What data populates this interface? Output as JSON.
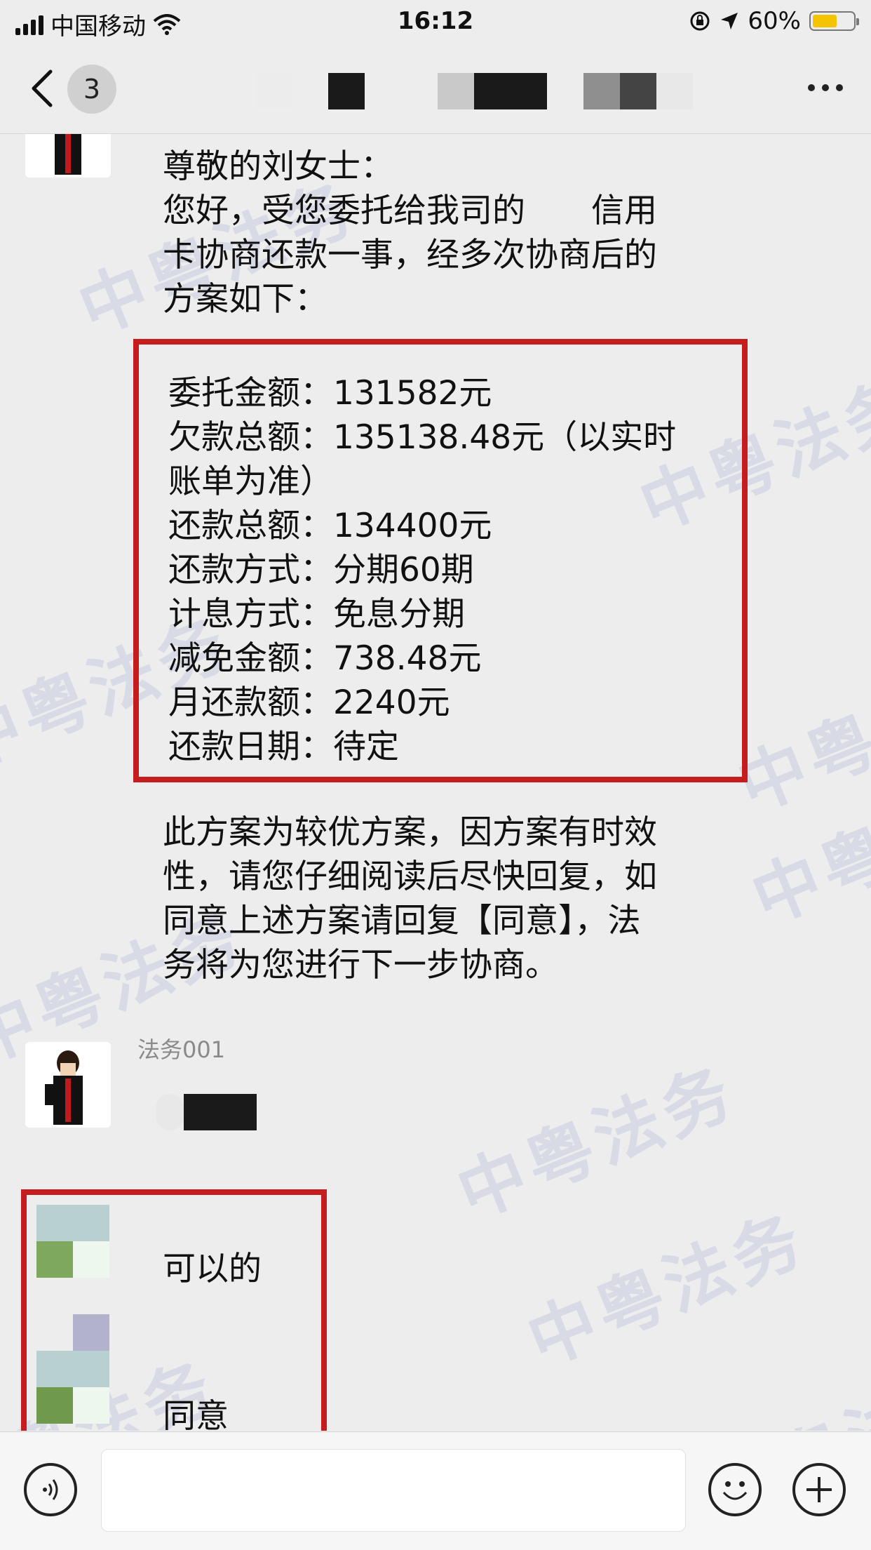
{
  "status_bar": {
    "carrier": "中国移动",
    "time": "16:12",
    "battery": "60%"
  },
  "nav": {
    "unread_count": "3"
  },
  "messages": {
    "intro_lines": [
      "尊敬的刘女士：",
      "您好，受您委托给我司的　　信用",
      "卡协商还款一事，经多次协商后的",
      "方案如下："
    ],
    "plan_lines": [
      "委托金额：131582元",
      "欠款总额：135138.48元（以实时",
      "账单为准）",
      "还款总额：134400元",
      "还款方式：分期60期",
      "计息方式：免息分期",
      "减免金额：738.48元",
      "月还款额：2240元",
      "还款日期：待定"
    ],
    "closing_lines": [
      "此方案为较优方案，因方案有时效",
      "性，请您仔细阅读后尽快回复，如",
      "同意上述方案请回复【同意】，法",
      "务将为您进行下一步协商。"
    ],
    "sender_name": "法务001",
    "replies": [
      "可以的",
      "同意"
    ]
  },
  "watermark_text": "中粤法务",
  "colors": {
    "highlight_border": "#c51d1d",
    "background": "#ededed",
    "watermark": "#7887c8"
  }
}
